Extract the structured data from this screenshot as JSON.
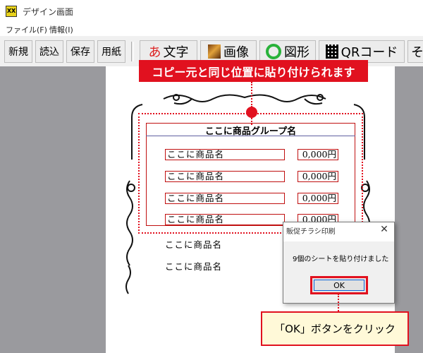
{
  "window": {
    "title": "デザイン画面",
    "icon_label": "XX"
  },
  "menu": [
    {
      "label": "ファイル(F)"
    },
    {
      "label": "情報(I)"
    }
  ],
  "toolbar": {
    "small_buttons": [
      {
        "label": "新規"
      },
      {
        "label": "読込"
      },
      {
        "label": "保存"
      },
      {
        "label": "用紙"
      }
    ],
    "big_buttons": [
      {
        "label": "文字",
        "icon_text": "あ",
        "icon": "hiragana-a-icon"
      },
      {
        "label": "画像",
        "icon": "image-icon"
      },
      {
        "label": "図形",
        "icon": "circle-shape-icon"
      },
      {
        "label": "QRコード",
        "icon": "qr-code-icon"
      },
      {
        "label": "そ"
      }
    ]
  },
  "callout_top": "コピー元と同じ位置に貼り付けられます",
  "canvas": {
    "group_title": "ここに商品グループ名",
    "products": [
      {
        "name": "ここに商品名",
        "price": "0,000円"
      },
      {
        "name": "ここに商品名",
        "price": "0,000円"
      },
      {
        "name": "ここに商品名",
        "price": "0,000円"
      },
      {
        "name": "ここに商品名",
        "price": "0,000円"
      }
    ],
    "plain_products": [
      {
        "name": "ここに商品名"
      },
      {
        "name": "ここに商品名"
      }
    ]
  },
  "dialog": {
    "title": "販促チラシ印刷",
    "close_label": "✕",
    "message": "9個のシートを貼り付けました",
    "ok_label": "OK"
  },
  "callout_bottom": "「OK」ボタンをクリック",
  "colors": {
    "accent_red": "#e1111f",
    "callout_bg": "#fff9d8"
  }
}
